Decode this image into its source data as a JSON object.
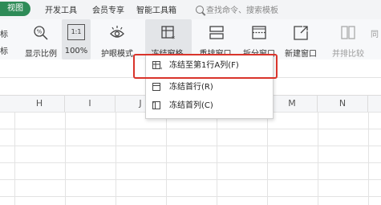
{
  "menubar": {
    "active_tab": "视图",
    "tabs": [
      "开发工具",
      "会员专享",
      "智能工具箱"
    ],
    "search_placeholder": "查找命令、搜索模板"
  },
  "ribbon": {
    "partial_left": [
      "标",
      "标"
    ],
    "display_ratio": "显示比例",
    "zoom_box": "1:1",
    "zoom_pct": "100%",
    "eye_mode": "护眼模式",
    "freeze": "冻结窗格",
    "rearrange": "重排窗口",
    "split": "拆分窗口",
    "new_window": "新建窗口",
    "compare": "并排比较",
    "partial_right": "同"
  },
  "columns": [
    "H",
    "I",
    "J",
    "M",
    "N"
  ],
  "freeze_menu": {
    "items": [
      {
        "label": "冻结至第1行A列(F)"
      },
      {
        "label": "冻结首行(R)"
      },
      {
        "label": "冻结首列(C)"
      }
    ]
  },
  "colors": {
    "active_tab_bg": "#2e8b57",
    "highlight": "#d9342b"
  }
}
